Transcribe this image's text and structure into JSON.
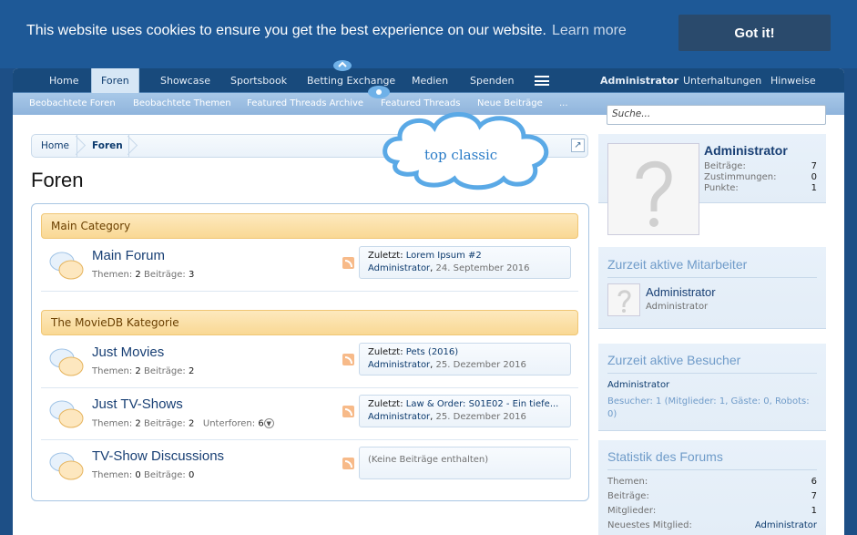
{
  "cookie": {
    "message": "This website uses cookies to ensure you get the best experience on our website.",
    "learn_more": "Learn more",
    "button": "Got it!"
  },
  "nav": {
    "tabs": [
      "Home",
      "Foren",
      "Showcase",
      "Sportsbook",
      "Betting Exchange",
      "Medien",
      "Spenden"
    ],
    "active_tab": "Foren",
    "right": [
      "Administrator",
      "Unterhaltungen",
      "Hinweise"
    ]
  },
  "subnav": [
    "Beobachtete Foren",
    "Beobachtete Themen",
    "Featured Threads Archive",
    "Featured Threads",
    "Neue Beiträge",
    "..."
  ],
  "search": {
    "placeholder": "Suche..."
  },
  "breadcrumb": [
    "Home",
    "Foren"
  ],
  "page_title": "Foren",
  "cloud_label": "top classic",
  "categories": [
    {
      "title": "Main Category",
      "forums": [
        {
          "title": "Main Forum",
          "stats_label1": "Themen:",
          "stats_val1": "2",
          "stats_label2": "Beiträge:",
          "stats_val2": "3",
          "last_prefix": "Zuletzt:",
          "last_title": "Lorem Ipsum #2",
          "last_user": "Administrator",
          "last_date": "24. September 2016"
        }
      ]
    },
    {
      "title": "The MovieDB Kategorie",
      "forums": [
        {
          "title": "Just Movies",
          "stats_label1": "Themen:",
          "stats_val1": "2",
          "stats_label2": "Beiträge:",
          "stats_val2": "2",
          "last_prefix": "Zuletzt:",
          "last_title": "Pets (2016)",
          "last_user": "Administrator",
          "last_date": "25. Dezember 2016"
        },
        {
          "title": "Just TV-Shows",
          "stats_label1": "Themen:",
          "stats_val1": "2",
          "stats_label2": "Beiträge:",
          "stats_val2": "2",
          "stats_label3": "Unterforen:",
          "stats_val3": "6",
          "last_prefix": "Zuletzt:",
          "last_title": "Law & Order: S01E02 - Ein tiefe...",
          "last_user": "Administrator",
          "last_date": "25. Dezember 2016"
        },
        {
          "title": "TV-Show Discussions",
          "stats_label1": "Themen:",
          "stats_val1": "0",
          "stats_label2": "Beiträge:",
          "stats_val2": "0",
          "empty": "(Keine Beiträge enthalten)"
        }
      ]
    }
  ],
  "sidebar": {
    "user": {
      "name": "Administrator",
      "stats": [
        {
          "label": "Beiträge:",
          "value": "7"
        },
        {
          "label": "Zustimmungen:",
          "value": "0"
        },
        {
          "label": "Punkte:",
          "value": "1"
        }
      ]
    },
    "staff": {
      "heading": "Zurzeit aktive Mitarbeiter",
      "name": "Administrator",
      "role": "Administrator"
    },
    "visitors": {
      "heading": "Zurzeit aktive Besucher",
      "name": "Administrator",
      "summary_line1": "Besucher: 1 (Mitglieder: 1, Gäste: 0, Robots:",
      "summary_line2": "0)"
    },
    "stats": {
      "heading": "Statistik des Forums",
      "rows": [
        {
          "label": "Themen:",
          "value": "6"
        },
        {
          "label": "Beiträge:",
          "value": "7"
        },
        {
          "label": "Mitglieder:",
          "value": "1"
        },
        {
          "label": "Neuestes Mitglied:",
          "value": "Administrator"
        }
      ]
    }
  }
}
